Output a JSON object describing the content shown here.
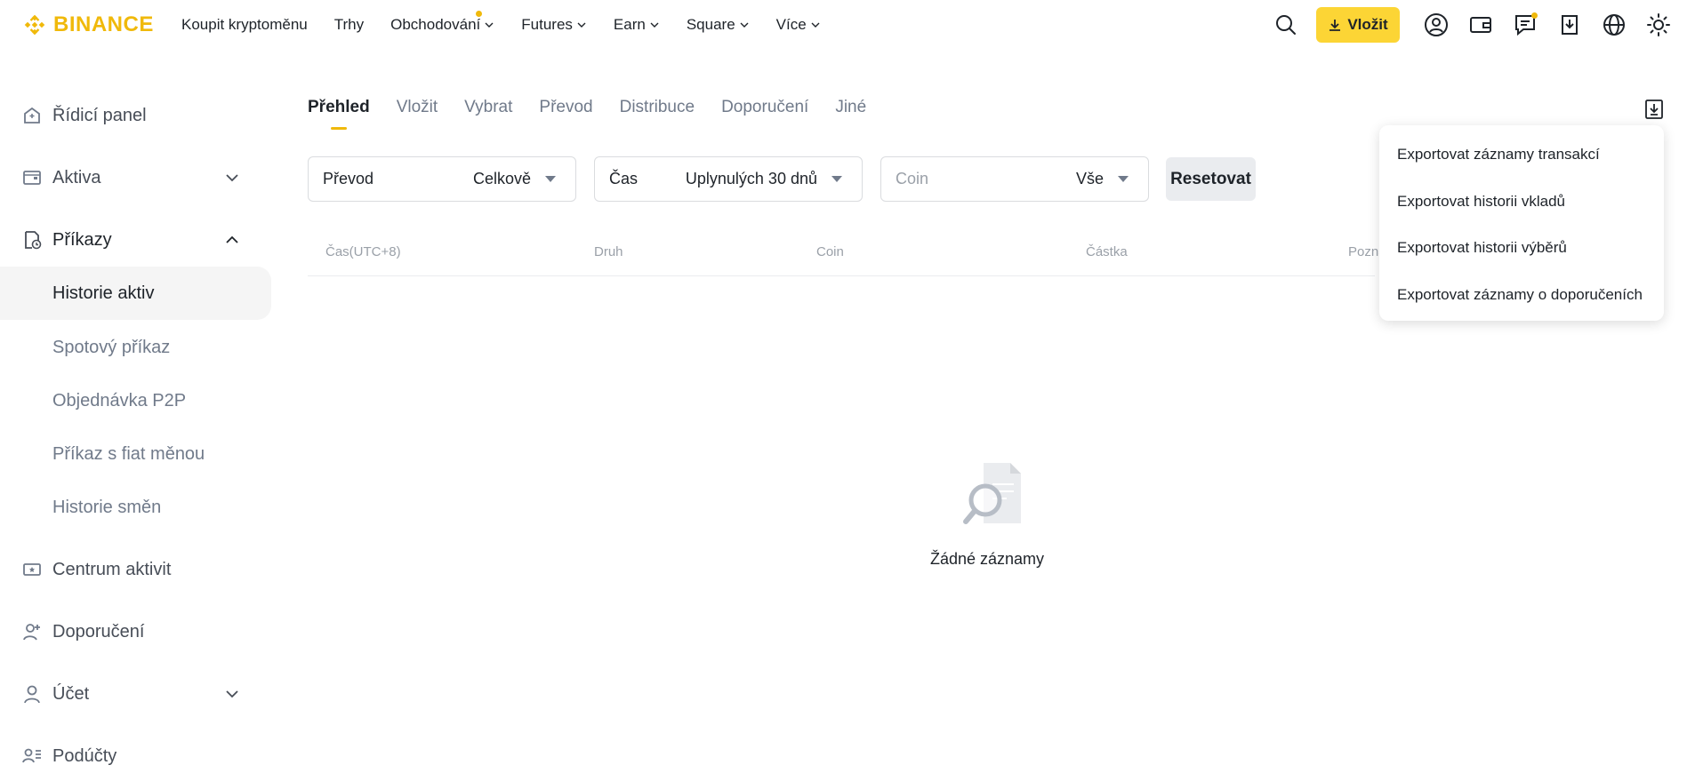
{
  "header": {
    "brand": "BINANCE",
    "brand_color": "#F0B90B",
    "nav": [
      {
        "label": "Koupit kryptoměnu",
        "dropdown": false
      },
      {
        "label": "Trhy",
        "dropdown": false
      },
      {
        "label": "Obchodování",
        "dropdown": true,
        "dot": true
      },
      {
        "label": "Futures",
        "dropdown": true
      },
      {
        "label": "Earn",
        "dropdown": true
      },
      {
        "label": "Square",
        "dropdown": true
      },
      {
        "label": "Více",
        "dropdown": true
      }
    ],
    "deposit_label": "Vložit",
    "icons": [
      "search-icon",
      "user-icon",
      "wallet-icon",
      "messages-icon",
      "download-icon",
      "globe-icon",
      "theme-sun-icon"
    ]
  },
  "sidebar": {
    "dashboard": "Řídicí panel",
    "assets": "Aktiva",
    "orders": "Příkazy",
    "orders_sub": [
      "Historie aktiv",
      "Spotový příkaz",
      "Objednávka P2P",
      "Příkaz s fiat měnou",
      "Historie směn"
    ],
    "activity_center": "Centrum aktivit",
    "referral": "Doporučení",
    "account": "Účet",
    "subaccounts": "Podúčty"
  },
  "tabs": [
    "Přehled",
    "Vložit",
    "Vybrat",
    "Převod",
    "Distribuce",
    "Doporučení",
    "Jiné"
  ],
  "filters": {
    "type_label": "Převod",
    "type_value": "Celkově",
    "time_label": "Čas",
    "time_value": "Uplynulých 30 dnů",
    "coin_placeholder": "Coin",
    "coin_value": "Vše",
    "reset": "Resetovat"
  },
  "table": {
    "columns": [
      "Čas(UTC+8)",
      "Druh",
      "Coin",
      "Částka",
      "Pozná"
    ]
  },
  "empty_state": "Žádné záznamy",
  "export_menu": [
    "Exportovat záznamy transakcí",
    "Exportovat historii vkladů",
    "Exportovat historii výběrů",
    "Exportovat záznamy o doporučeních"
  ]
}
